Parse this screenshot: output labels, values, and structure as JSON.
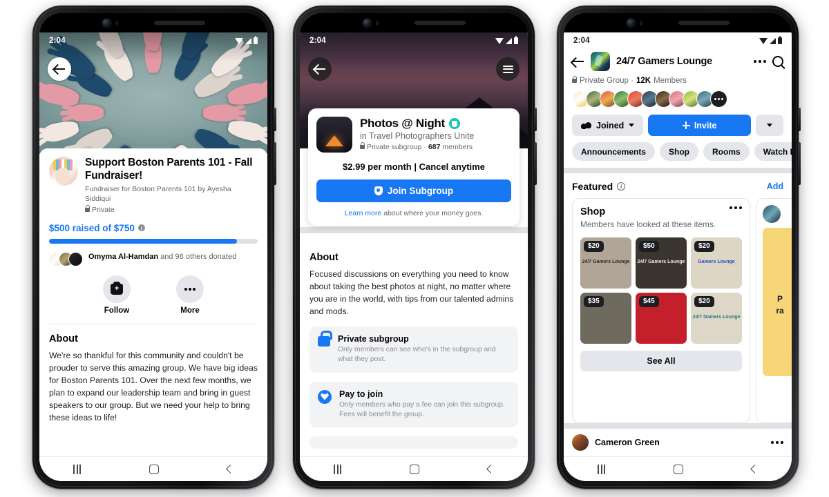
{
  "phones": {
    "one": {
      "status": {
        "time": "2:04"
      },
      "cover_alt": "paper-cutout-hands-circle",
      "back_label": "Back",
      "fundraiser": {
        "title": "Support Boston Parents 101 - Fall Fundraiser!",
        "subtitle": "Fundraiser for Boston Parents 101 by Ayesha Siddiqui",
        "privacy": "Private",
        "raised_text": "$500 raised of $750",
        "progress_percent": 90,
        "donors_lead": "Omyma Al-Hamdan",
        "donors_rest": " and 98 others donated"
      },
      "actions": [
        {
          "label": "Follow",
          "icon": "follow-plus-icon"
        },
        {
          "label": "More",
          "icon": "ellipsis-icon"
        }
      ],
      "about": {
        "heading": "About",
        "text": "We're so thankful for this community and couldn't be prouder to serve this amazing group. We have big ideas for Boston Parents 101. Over the next few months, we plan to expand our leadership team and bring in guest speakers to our group. But we need your help to bring these ideas to life!"
      }
    },
    "two": {
      "status": {
        "time": "2:04"
      },
      "cover_alt": "night-mountain-hikers",
      "subgroup": {
        "name": "Photos @ Night",
        "parent": "in Travel Photographers Unite",
        "privacy": "Private subgroup",
        "member_count": "687",
        "member_word": " members",
        "price": "$2.99 per month | Cancel anytime",
        "join_label": "Join Subgroup",
        "learn_link": "Learn more",
        "learn_rest": " about where your money goes."
      },
      "about": {
        "heading": "About",
        "text": "Focused discussions on everything you need to know about taking the best photos at night, no matter where you are in the world, with tips from our talented admins and mods."
      },
      "info_cards": [
        {
          "icon": "lock-icon",
          "title": "Private subgroup",
          "desc": "Only members can see who's in the subgroup and what they post."
        },
        {
          "icon": "pay-shield-icon",
          "title": "Pay to join",
          "desc": "Only members who pay a fee can join this subgroup. Fees will benefit the group."
        }
      ]
    },
    "three": {
      "status": {
        "time": "2:04"
      },
      "header": {
        "title": "24/7 Gamers Lounge",
        "back_icon": "arrow-left-icon",
        "menu_icon": "ellipsis-icon",
        "search_icon": "search-icon"
      },
      "meta": {
        "privacy": "Private Group · ",
        "members_count": "12K",
        "members_word": " Members"
      },
      "member_avatars": 10,
      "actions": {
        "joined_label": "Joined",
        "invite_label": "Invite",
        "more_icon": "chevron-down-icon"
      },
      "chips": [
        "Announcements",
        "Shop",
        "Rooms",
        "Watch P"
      ],
      "featured": {
        "heading": "Featured",
        "info_icon": "info-icon",
        "add_label": "Add"
      },
      "shop_card": {
        "title": "Shop",
        "subtitle": "Members have looked at these items.",
        "menu_icon": "ellipsis-icon",
        "products": [
          {
            "price": "$20",
            "art": "24/7 Gamers Lounge",
            "bg": "#b0a596",
            "ink": "#2b2b2b"
          },
          {
            "price": "$50",
            "art": "24/7 Gamers Lounge",
            "bg": "#3a352e",
            "ink": "#f0ece2"
          },
          {
            "price": "$20",
            "art": "Gamers Lounge",
            "bg": "#ddd6c4",
            "ink": "#2a49c8"
          },
          {
            "price": "$35",
            "art": "",
            "bg": "#6e6a5e",
            "ink": "#e8e4da"
          },
          {
            "price": "$45",
            "art": "",
            "bg": "#c4202c",
            "ink": "#ffffff"
          },
          {
            "price": "$20",
            "art": "24/7 Gamers Lounge",
            "bg": "#ded6c6",
            "ink": "#1d7d86"
          }
        ],
        "see_all_label": "See All"
      },
      "side_card": {
        "text": "P\nra"
      },
      "post": {
        "author": "Cameron Green",
        "menu_icon": "ellipsis-icon"
      }
    }
  },
  "nav": {
    "recents": "recents-button",
    "home": "home-button",
    "back": "back-button"
  },
  "colors": {
    "accent": "#1877F2",
    "teal": "#19c4b0",
    "gray_bg": "#e4e6eb",
    "text": "#050505"
  }
}
